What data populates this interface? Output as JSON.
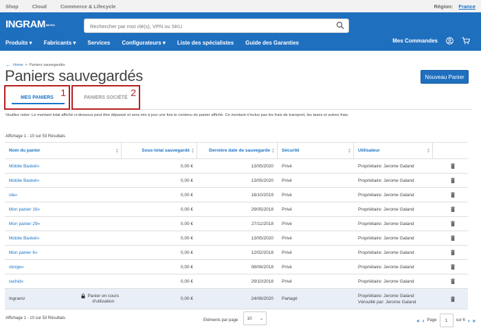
{
  "topbar": {
    "links": [
      "Shop",
      "Cloud",
      "Commerce & Lifecycle"
    ],
    "region_label": "Région:",
    "region_value": "France"
  },
  "header": {
    "logo": "INGRAM",
    "logo_sub": "MICRO",
    "search_placeholder": "Rechercher par mot clé(s), VPN ou SKU",
    "nav": [
      "Produits ▾",
      "Fabricants ▾",
      "Services",
      "Configurateurs ▾",
      "Liste des spécialistes",
      "Guide des Garanties"
    ],
    "orders": "Mes Commandes"
  },
  "breadcrumb": {
    "home": "Home",
    "current": "Paniers sauvegardés"
  },
  "page_title": "Paniers sauvegardés",
  "new_button": "Nouveau Panier",
  "tabs": [
    {
      "label": "MES PANIERS",
      "num": "1"
    },
    {
      "label": "PANIERS SOCIÉTÉ",
      "num": "2"
    }
  ],
  "notice": "Veuillez noter: Le montant total affiché ci-dessous peut être dépassé et sera mis à jour une fois le contenu du panier affiché. Ce montant n'inclus pas les frais de transport, les taxes et autres frais.",
  "results_label": "Affichage 1 - 10 sur 53 Résultats",
  "columns": [
    "Nom du panier",
    "Sous-total sauvegardé",
    "Dernière date de sauvegarde",
    "Sécurité",
    "Utilisateur"
  ],
  "rows": [
    {
      "name": "Mobile Basket»",
      "total": "0,00 €",
      "date": "13/05/2020",
      "security": "Privé",
      "user": "Propriétaire: Jerome Galand"
    },
    {
      "name": "Mobile Basket»",
      "total": "0,00 €",
      "date": "13/05/2020",
      "security": "Privé",
      "user": "Propriétaire: Jerome Galand"
    },
    {
      "name": "ola»",
      "total": "0,00 €",
      "date": "18/10/2019",
      "security": "Privé",
      "user": "Propriétaire: Jerome Galand"
    },
    {
      "name": "Mon panier 16»",
      "total": "0,00 €",
      "date": "29/05/2018",
      "security": "Privé",
      "user": "Propriétaire: Jerome Galand"
    },
    {
      "name": "Mon panier 29»",
      "total": "0,00 €",
      "date": "27/11/2018",
      "security": "Privé",
      "user": "Propriétaire: Jerome Galand"
    },
    {
      "name": "Mobile Basket»",
      "total": "0,00 €",
      "date": "13/05/2020",
      "security": "Privé",
      "user": "Propriétaire: Jerome Galand"
    },
    {
      "name": "Mon panier 6»",
      "total": "0,00 €",
      "date": "12/02/2018",
      "security": "Privé",
      "user": "Propriétaire: Jerome Galand"
    },
    {
      "name": "storge»",
      "total": "0,00 €",
      "date": "08/06/2018",
      "security": "Privé",
      "user": "Propriétaire: Jerome Galand"
    },
    {
      "name": "rachid»",
      "total": "0,00 €",
      "date": "29/10/2018",
      "security": "Privé",
      "user": "Propriétaire: Jerome Galand"
    }
  ],
  "last_row": {
    "name": "Ingramz",
    "lock_text_1": "Panier en cours",
    "lock_text_2": "d'utilisation",
    "total": "0,00 €",
    "date": "24/06/2020",
    "security": "Partagé",
    "user_1": "Propriétaire: Jerome Galand",
    "user_2": "Vérouillé par: Jerome Galand"
  },
  "footer": {
    "per_page_label": "Eléments par page",
    "per_page_value": "10",
    "page_label": "Page",
    "page_value": "1",
    "page_total": "sur 6"
  },
  "colors": {
    "brand": "#1f6fbf",
    "link": "#1a73c8",
    "annotation": "#b71c1c"
  }
}
